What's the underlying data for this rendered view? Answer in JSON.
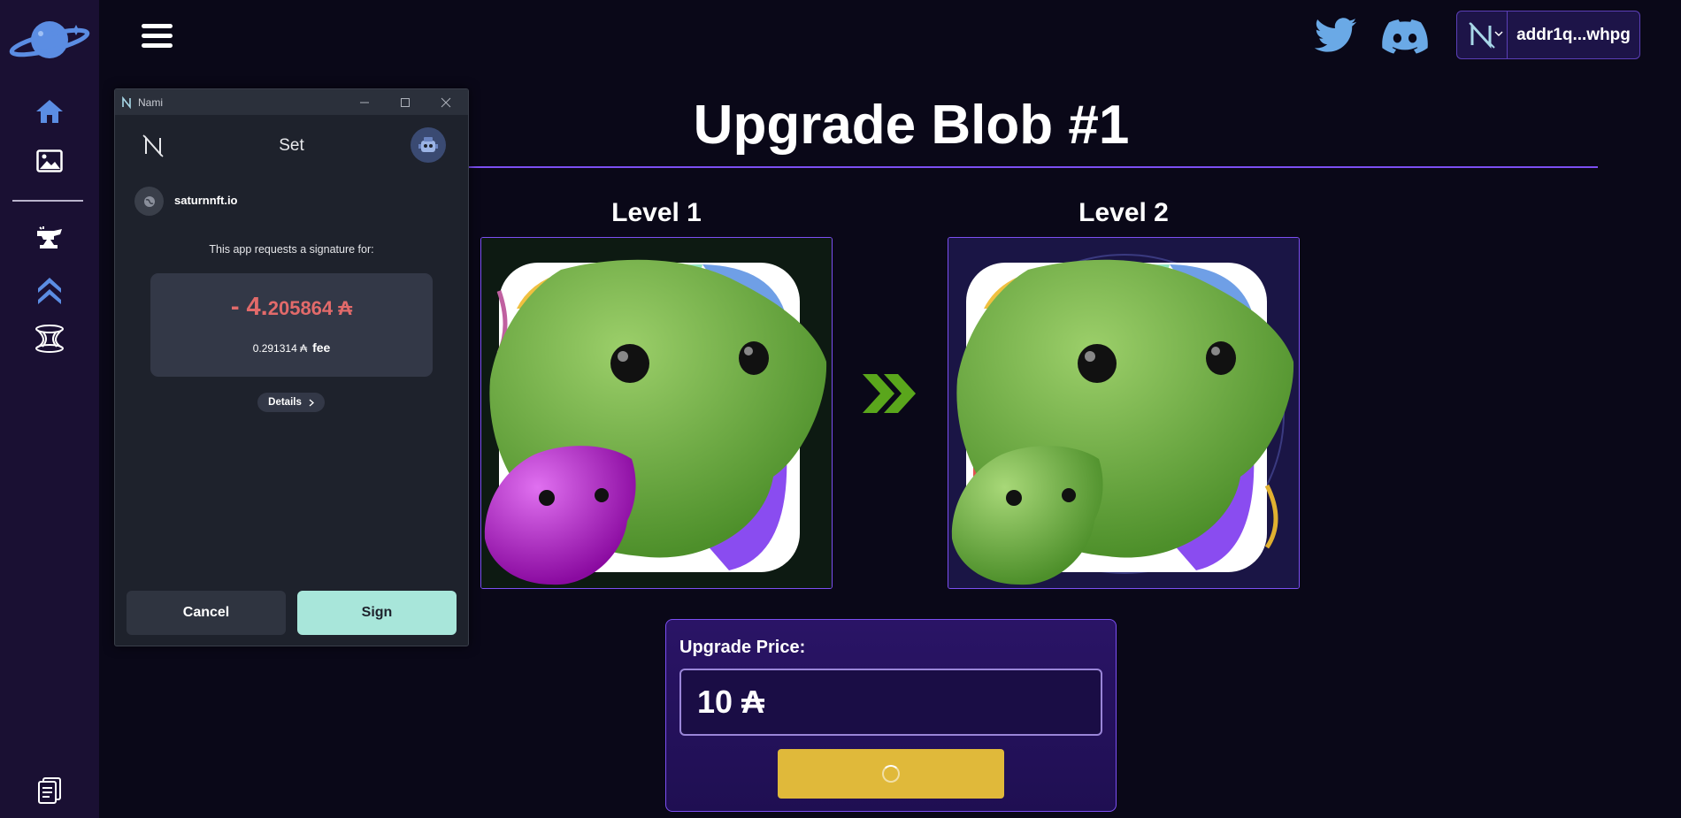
{
  "sidebar": {
    "icons": [
      "saturn-logo",
      "home-icon",
      "image-icon",
      "anvil-icon",
      "upgrade-chevrons-icon",
      "portal-icon",
      "document-icon"
    ]
  },
  "topbar": {
    "wallet_address": "addr1q...whpg",
    "social": [
      "twitter-icon",
      "discord-icon"
    ]
  },
  "main": {
    "title": "Upgrade Blob #1",
    "from_level": "Level 1",
    "to_level": "Level 2",
    "price_label": "Upgrade Price:",
    "price_value": "10 ₳",
    "colors": {
      "accent": "#7c4ff2",
      "upgrade_button": "#e0b93a",
      "arrow": "#5aa61c"
    }
  },
  "nami": {
    "window_title": "Nami",
    "header_title": "Set",
    "site": "saturnnft.io",
    "request_text": "This app requests a signature for:",
    "amount_big": "- 4.",
    "amount_small": "205864 ₳",
    "fee_amount": "0.291314 ₳",
    "fee_label": "fee",
    "details_label": "Details",
    "cancel_label": "Cancel",
    "sign_label": "Sign",
    "colors": {
      "amount": "#e26a6a",
      "sign_button": "#a8e6da"
    }
  }
}
